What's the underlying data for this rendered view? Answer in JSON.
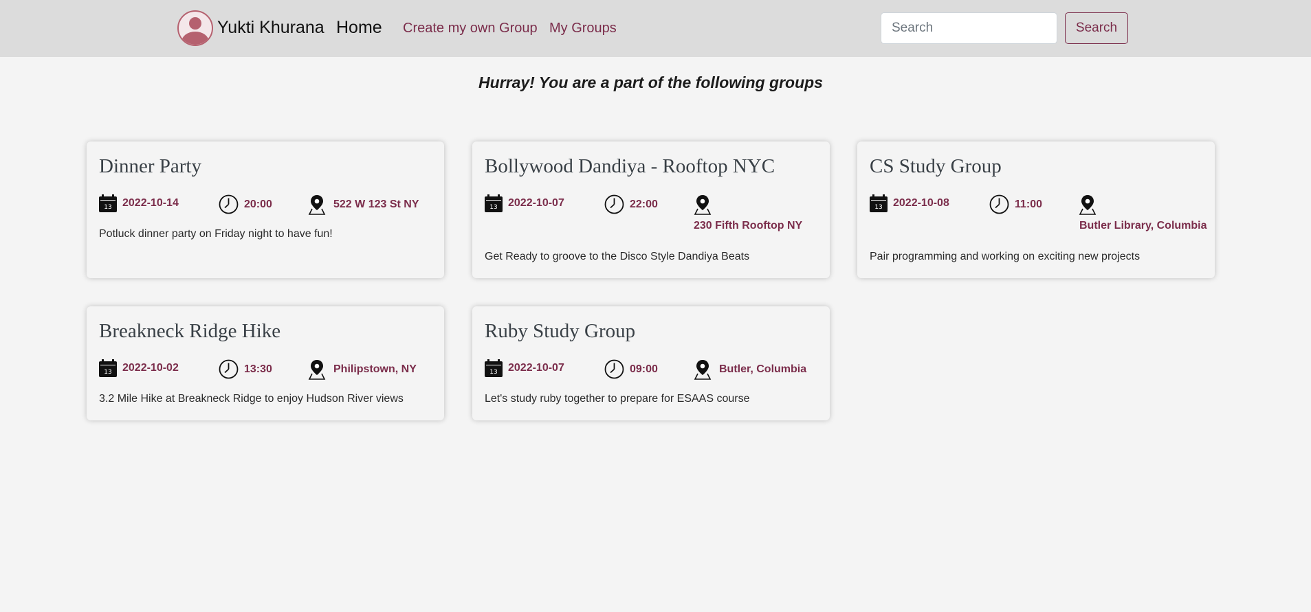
{
  "navbar": {
    "brand": "Yukti Khurana",
    "home": "Home",
    "create_group": "Create my own Group",
    "my_groups": "My Groups",
    "search_placeholder": "Search",
    "search_button": "Search"
  },
  "heading": "Hurray! You are a part of the following groups",
  "calendar_day": "13",
  "groups": [
    {
      "title": "Dinner Party",
      "date": "2022-10-14",
      "time": "20:00",
      "location": "522 W 123 St NY",
      "description": "Potluck dinner party on Friday night to have fun!"
    },
    {
      "title": "Bollywood Dandiya - Rooftop NYC",
      "date": "2022-10-07",
      "time": "22:00",
      "location": "230 Fifth Rooftop NY",
      "description": "Get Ready to groove to the Disco Style Dandiya Beats"
    },
    {
      "title": "CS Study Group",
      "date": "2022-10-08",
      "time": "11:00",
      "location": "Butler Library, Columbia",
      "description": "Pair programming and working on exciting new projects"
    },
    {
      "title": "Breakneck Ridge Hike",
      "date": "2022-10-02",
      "time": "13:30",
      "location": "Philipstown, NY",
      "description": "3.2 Mile Hike at Breakneck Ridge to enjoy Hudson River views"
    },
    {
      "title": "Ruby Study Group",
      "date": "2022-10-07",
      "time": "09:00",
      "location": "Butler, Columbia",
      "description": "Let's study ruby together to prepare for ESAAS course"
    }
  ],
  "colors": {
    "navbar_bg": "#dcdcdc",
    "accent": "#7b2d4b",
    "avatar": "#b5616f",
    "page_bg": "#f4f4f4"
  },
  "icons": [
    "user-avatar-icon",
    "calendar-icon",
    "clock-icon",
    "map-pin-icon"
  ]
}
